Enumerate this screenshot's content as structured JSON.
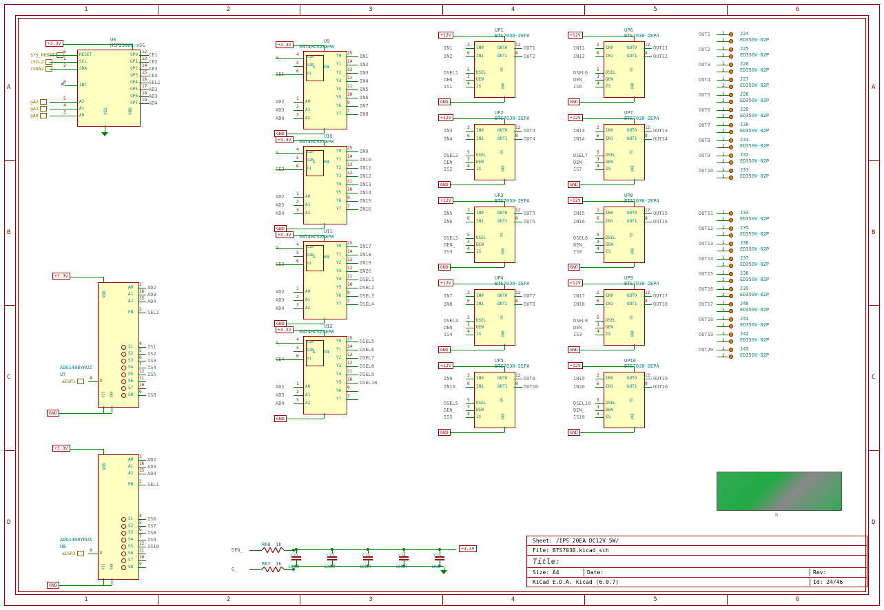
{
  "frame": {
    "cols": [
      "1",
      "2",
      "3",
      "4",
      "5",
      "6"
    ],
    "rows": [
      "A",
      "B",
      "C",
      "D"
    ]
  },
  "power": {
    "v33": "+3.3V",
    "v12": "+12V",
    "gnd": "GND"
  },
  "u6": {
    "ref": "U6",
    "value": "MCP23008-xSS",
    "left_pins": [
      {
        "n": "6",
        "lbl": "RESET",
        "net": "SYS_RESET"
      },
      {
        "n": "1",
        "lbl": "SCL",
        "net": "iSCL2"
      },
      {
        "n": "2",
        "lbl": "SDA",
        "net": "iSDA2"
      },
      {
        "n": "8",
        "lbl": "INT",
        "net": ""
      },
      {
        "n": "5",
        "lbl": "A2",
        "net": "gA2"
      },
      {
        "n": "4",
        "lbl": "A1",
        "net": "gA1"
      },
      {
        "n": "3",
        "lbl": "A0",
        "net": "gA0"
      }
    ],
    "right_pins": [
      {
        "n": "12",
        "lbl": "GP0",
        "net": "CE1"
      },
      {
        "n": "13",
        "lbl": "GP1",
        "net": "CE2"
      },
      {
        "n": "14",
        "lbl": "GP2",
        "net": "CE3"
      },
      {
        "n": "15",
        "lbl": "GP3",
        "net": "CE4"
      },
      {
        "n": "16",
        "lbl": "GP4",
        "net": "SEL1"
      },
      {
        "n": "17",
        "lbl": "GP5",
        "net": "AD2"
      },
      {
        "n": "18",
        "lbl": "GP6",
        "net": "AD3"
      },
      {
        "n": "19",
        "lbl": "GP7",
        "net": "AD4"
      }
    ],
    "top": {
      "n": "10",
      "lbl": "VDD"
    },
    "bot": {
      "n": "9",
      "lbl": "VSS"
    }
  },
  "mux_common": {
    "value": "ADG1408YRUZ",
    "right_pins": [
      {
        "n": "1",
        "lbl": "A0"
      },
      {
        "n": "16",
        "lbl": "A1"
      },
      {
        "n": "15",
        "lbl": "A2"
      },
      {
        "n": "2",
        "lbl": "EN"
      },
      {
        "n": "4",
        "lbl": "S1"
      },
      {
        "n": "5",
        "lbl": "S2"
      },
      {
        "n": "6",
        "lbl": "S3"
      },
      {
        "n": "7",
        "lbl": "S4"
      },
      {
        "n": "12",
        "lbl": "S5"
      },
      {
        "n": "11",
        "lbl": "S6"
      },
      {
        "n": "10",
        "lbl": "S7"
      },
      {
        "n": "9",
        "lbl": "S8"
      }
    ],
    "top": {
      "n": "13",
      "lbl": "VDD"
    },
    "bot1": {
      "n": "3",
      "lbl": "VSS"
    },
    "bot2": {
      "n": "14",
      "lbl": "GND"
    }
  },
  "u7": {
    "ref": "U7",
    "d_net": "aISP1",
    "addr": [
      "AD2",
      "AD3",
      "AD4"
    ],
    "en": "SEL1",
    "s": [
      "IS1",
      "IS2",
      "IS3",
      "IS4",
      "IS5",
      "",
      "",
      "IS8"
    ]
  },
  "u8": {
    "ref": "U8",
    "d_net": "aISP2",
    "addr": [
      "AD2",
      "AD3",
      "AD4"
    ],
    "en": "SEL1",
    "s": [
      "IS6",
      "IS7",
      "IS8",
      "IS9",
      "IS10",
      "",
      "",
      ""
    ]
  },
  "decoders": [
    {
      "ref": "U9",
      "ce": "CE1",
      "y": [
        "IN1",
        "IN2",
        "IN3",
        "IN4",
        "IN5",
        "IN6",
        "IN7",
        "IN8"
      ]
    },
    {
      "ref": "U10",
      "ce": "CE2",
      "y": [
        "IN9",
        "IN10",
        "IN11",
        "IN12",
        "IN13",
        "IN14",
        "IN15",
        "IN16"
      ]
    },
    {
      "ref": "U11",
      "ce": "CE3",
      "y": [
        "IN17",
        "IN18",
        "IN19",
        "IN20",
        "DSEL1",
        "DSEL2",
        "DSEL3",
        "DSEL4"
      ]
    },
    {
      "ref": "U12",
      "ce": "CE4",
      "y": [
        "DSEL5",
        "DSEL6",
        "DSEL7",
        "DSEL8",
        "DSEL9",
        "DSEL10",
        "",
        ""
      ]
    }
  ],
  "decoder_common": {
    "value": "SN74HCS238PW",
    "addr": [
      "AD2",
      "AD3",
      "AD4"
    ],
    "g_net": "G_",
    "pins_y": [
      "15",
      "14",
      "13",
      "12",
      "11",
      "10",
      "9",
      "7"
    ],
    "pins_a": [
      "1",
      "2",
      "3"
    ],
    "pins_g": [
      "4",
      "5",
      "6"
    ],
    "lbls_g": [
      "G2A",
      "G2B",
      "G1"
    ],
    "en_lbl": "EN"
  },
  "drivers": [
    {
      "ref": "UP1",
      "in": [
        "IN1",
        "IN2"
      ],
      "out": [
        "OUT1",
        "OUT2"
      ],
      "dsel": "DSEL1",
      "is": "IS1"
    },
    {
      "ref": "UP2",
      "in": [
        "IN3",
        "IN4"
      ],
      "out": [
        "OUT3",
        "OUT4"
      ],
      "dsel": "DSEL2",
      "is": "IS2"
    },
    {
      "ref": "UP3",
      "in": [
        "IN5",
        "IN6"
      ],
      "out": [
        "OUT5",
        "OUT6"
      ],
      "dsel": "DSEL3",
      "is": "IS3"
    },
    {
      "ref": "UP4",
      "in": [
        "IN7",
        "IN8"
      ],
      "out": [
        "OUT7",
        "OUT8"
      ],
      "dsel": "DSEL4",
      "is": "IS4"
    },
    {
      "ref": "UP5",
      "in": [
        "IN9",
        "IN10"
      ],
      "out": [
        "OUT9",
        "OUT10"
      ],
      "dsel": "DSEL5",
      "is": "IS5"
    },
    {
      "ref": "UP6",
      "in": [
        "IN11",
        "IN12"
      ],
      "out": [
        "OUT11",
        "OUT12"
      ],
      "dsel": "DSEL6",
      "is": "IS6"
    },
    {
      "ref": "UP7",
      "in": [
        "IN13",
        "IN14"
      ],
      "out": [
        "OUT13",
        "OUT14"
      ],
      "dsel": "DSEL7",
      "is": "IS7"
    },
    {
      "ref": "UP8",
      "in": [
        "IN15",
        "IN16"
      ],
      "out": [
        "OUT15",
        "OUT16"
      ],
      "dsel": "DSEL8",
      "is": "IS8"
    },
    {
      "ref": "UP9",
      "in": [
        "IN17",
        "IN18"
      ],
      "out": [
        "OUT17",
        "OUT18"
      ],
      "dsel": "DSEL9",
      "is": "IS9"
    },
    {
      "ref": "UP10",
      "in": [
        "IN19",
        "IN20"
      ],
      "out": [
        "OUT19",
        "OUT20"
      ],
      "dsel": "DSEL10",
      "is": "IS10"
    }
  ],
  "driver_common": {
    "value": "BTS7030-2EPA",
    "pins_left": [
      {
        "n": "2",
        "lbl": "IN0"
      },
      {
        "n": "6",
        "lbl": "IN1"
      },
      {
        "n": "5",
        "lbl": "DSEL"
      },
      {
        "n": "3",
        "lbl": "DEN"
      },
      {
        "n": "4",
        "lbl": "IS"
      }
    ],
    "pins_right": [
      {
        "n": "12",
        "lbl": "OUT0"
      },
      {
        "n": "8",
        "lbl": "OUT1"
      }
    ],
    "top": {
      "n": "1",
      "lbl": "VS"
    },
    "bot": {
      "n": "7",
      "lbl": "GND"
    },
    "den_net": "DEN_"
  },
  "connectors": [
    {
      "ref": "J24",
      "out": "OUT1"
    },
    {
      "ref": "J25",
      "out": "OUT2"
    },
    {
      "ref": "J26",
      "out": "OUT3"
    },
    {
      "ref": "J27",
      "out": "OUT4"
    },
    {
      "ref": "J28",
      "out": "OUT5"
    },
    {
      "ref": "J29",
      "out": "OUT6"
    },
    {
      "ref": "J30",
      "out": "OUT7"
    },
    {
      "ref": "J31",
      "out": "OUT8"
    },
    {
      "ref": "J32",
      "out": "OUT9"
    },
    {
      "ref": "J33",
      "out": "OUT10"
    },
    {
      "ref": "J34",
      "out": "OUT11"
    },
    {
      "ref": "J35",
      "out": "OUT12"
    },
    {
      "ref": "J36",
      "out": "OUT13"
    },
    {
      "ref": "J37",
      "out": "OUT14"
    },
    {
      "ref": "J38",
      "out": "OUT15"
    },
    {
      "ref": "J39",
      "out": "OUT16"
    },
    {
      "ref": "J40",
      "out": "OUT17"
    },
    {
      "ref": "J41",
      "out": "OUT18"
    },
    {
      "ref": "J42",
      "out": "OUT19"
    },
    {
      "ref": "J43",
      "out": "OUT20"
    }
  ],
  "conn_value": "ED350V-02P",
  "caps": [
    {
      "ref": "C71",
      "val": "100nF"
    },
    {
      "ref": "C72",
      "val": "100nF"
    },
    {
      "ref": "C73",
      "val": "100nF"
    },
    {
      "ref": "C74",
      "val": "100nF"
    },
    {
      "ref": "C75",
      "val": "10uF"
    }
  ],
  "resistors": [
    {
      "ref": "R68",
      "val": "1k",
      "net": "DEN_"
    },
    {
      "ref": "R67",
      "val": "1k",
      "net": "G_"
    }
  ],
  "title_block": {
    "sheet": "Sheet: /IPS 20EA DC12V 5W/",
    "file": "File: BTS7030.kicad_sch",
    "title_lbl": "Title:",
    "size_lbl": "Size:",
    "size": "A4",
    "date_lbl": "Date:",
    "date": "",
    "rev_lbl": "Rev:",
    "rev": "",
    "gen": "KiCad E.D.A.  kicad (6.0.7)",
    "id_lbl": "Id:",
    "id": "24/46"
  }
}
